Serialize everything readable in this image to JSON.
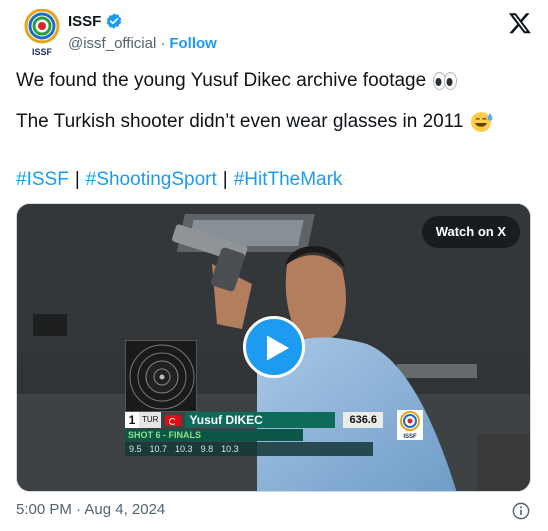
{
  "author": {
    "display_name": "ISSF",
    "handle": "@issf_official",
    "follow_label": "Follow",
    "avatar_text": "ISSF",
    "verified_icon": "verified-badge-icon"
  },
  "tweet": {
    "line1": "We found the young Yusuf Dikec archive footage",
    "line1_emoji": "eyes-emoji",
    "line2": "The Turkish shooter didn’t even wear glasses in 2011",
    "line2_emoji": "grinning-sweat-emoji",
    "hashtags": [
      "#ISSF",
      "#ShootingSport",
      "#HitTheMark"
    ],
    "hashtag_separator": "|"
  },
  "media": {
    "watch_label": "Watch on X",
    "scoreboard": {
      "rank": "1",
      "country": "TUR",
      "athlete": "Yusuf DIKEC",
      "total": "636.6",
      "shot_label": "SHOT 6 - FINALS",
      "scores": [
        "9.5",
        "10.7",
        "10.3",
        "9.8",
        "10.3"
      ],
      "logo_text": "ISSF"
    }
  },
  "footer": {
    "timestamp": "5:00 PM · Aug 4, 2024"
  },
  "colors": {
    "link": "#1d9bf0",
    "text": "#0f1419",
    "muted": "#536471"
  }
}
